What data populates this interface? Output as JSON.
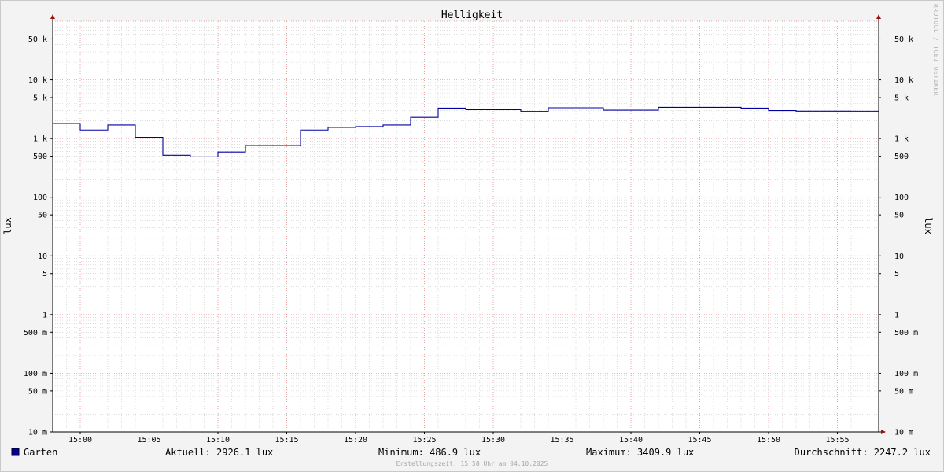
{
  "chart_data": {
    "type": "line",
    "title": "Helligkeit",
    "ylabel": "lux",
    "yscale": "log",
    "ylim": [
      0.01,
      100000
    ],
    "y_ticks": [
      {
        "value": 0.01,
        "label": "10 m"
      },
      {
        "value": 0.05,
        "label": "50 m"
      },
      {
        "value": 0.1,
        "label": "100 m"
      },
      {
        "value": 0.5,
        "label": "500 m"
      },
      {
        "value": 1,
        "label": "1"
      },
      {
        "value": 5,
        "label": "5"
      },
      {
        "value": 10,
        "label": "10"
      },
      {
        "value": 50,
        "label": "50"
      },
      {
        "value": 100,
        "label": "100"
      },
      {
        "value": 500,
        "label": "500"
      },
      {
        "value": 1000,
        "label": "1 k"
      },
      {
        "value": 5000,
        "label": "5 k"
      },
      {
        "value": 10000,
        "label": "10 k"
      },
      {
        "value": 50000,
        "label": "50 k"
      }
    ],
    "xlim": [
      "14:58",
      "15:58"
    ],
    "x_ticks": [
      "15:00",
      "15:05",
      "15:10",
      "15:15",
      "15:20",
      "15:25",
      "15:30",
      "15:35",
      "15:40",
      "15:45",
      "15:50",
      "15:55"
    ],
    "grid": true,
    "series": [
      {
        "name": "Garten",
        "color": "#0000a0",
        "step": true,
        "points": [
          [
            "14:58",
            1800
          ],
          [
            "15:00",
            1400
          ],
          [
            "15:02",
            1700
          ],
          [
            "15:04",
            1050
          ],
          [
            "15:06",
            520
          ],
          [
            "15:08",
            487
          ],
          [
            "15:10",
            590
          ],
          [
            "15:12",
            760
          ],
          [
            "15:14",
            760
          ],
          [
            "15:16",
            1400
          ],
          [
            "15:18",
            1550
          ],
          [
            "15:20",
            1600
          ],
          [
            "15:22",
            1700
          ],
          [
            "15:24",
            2300
          ],
          [
            "15:26",
            3300
          ],
          [
            "15:28",
            3100
          ],
          [
            "15:30",
            3100
          ],
          [
            "15:32",
            2900
          ],
          [
            "15:34",
            3350
          ],
          [
            "15:36",
            3350
          ],
          [
            "15:38",
            3050
          ],
          [
            "15:40",
            3050
          ],
          [
            "15:42",
            3410
          ],
          [
            "15:44",
            3410
          ],
          [
            "15:46",
            3410
          ],
          [
            "15:48",
            3300
          ],
          [
            "15:50",
            3000
          ],
          [
            "15:52",
            2930
          ],
          [
            "15:54",
            2930
          ],
          [
            "15:56",
            2926
          ]
        ],
        "end": "15:58"
      }
    ],
    "legend": {
      "series_name": "Garten",
      "current": "Aktuell: 2926.1 lux",
      "minimum": "Minimum: 486.9 lux",
      "maximum": "Maximum: 3409.9 lux",
      "average": "Durchschnitt: 2247.2 lux"
    },
    "watermark": "RRDTOOL / TOBI OETIKER",
    "footer": "Erstellungszeit: 15:58 Uhr am 04.10.2025",
    "colors": {
      "background": "#f3f3f3",
      "canvas": "#ffffff",
      "major_grid": "#e88c8c",
      "minor_grid": "#c8c8c8",
      "axis_arrow": "#a01010",
      "series": "#0000a0"
    }
  }
}
